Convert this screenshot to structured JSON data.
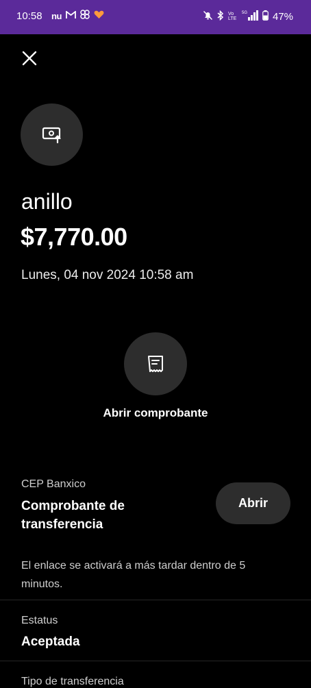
{
  "status_bar": {
    "time": "10:58",
    "apps_text": "nu",
    "battery_percent": "47%",
    "bg_color": "#5b2a9a",
    "icons": [
      "nu-icon",
      "gmail-icon",
      "pinwheel-icon",
      "heart-app-icon",
      "mute-icon",
      "bluetooth-icon",
      "volte-icon",
      "5g-signal-icon",
      "battery-icon"
    ]
  },
  "header": {
    "close_icon": "close-icon"
  },
  "transaction": {
    "icon": "transfer-out-icon",
    "title": "anillo",
    "amount": "$7,770.00",
    "date": "Lunes, 04 nov 2024 10:58 am"
  },
  "receipt": {
    "icon": "receipt-icon",
    "label": "Abrir comprobante"
  },
  "cep": {
    "label": "CEP Banxico",
    "title": "Comprobante de transferencia",
    "button_label": "Abrir",
    "note": "El enlace se activará a más tardar dentro de 5 minutos."
  },
  "details": {
    "status_label": "Estatus",
    "status_value": "Aceptada",
    "type_label": "Tipo de transferencia"
  }
}
